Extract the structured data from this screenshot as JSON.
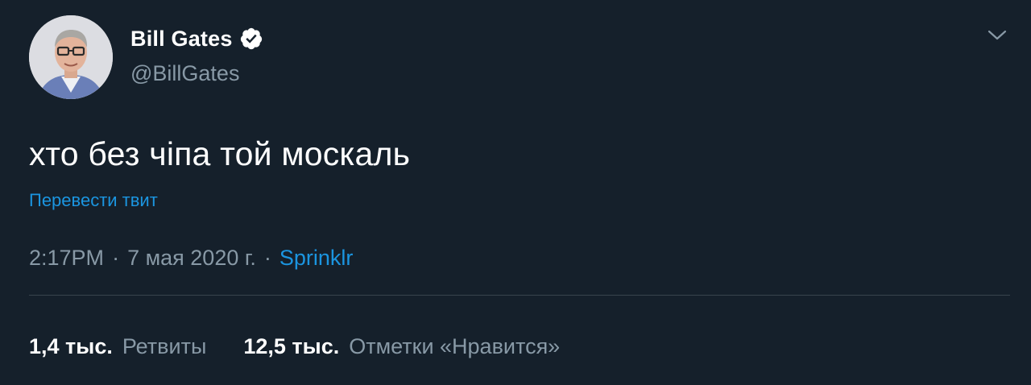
{
  "author": {
    "display_name": "Bill Gates",
    "handle": "@BillGates",
    "verified": true
  },
  "tweet": {
    "text": "хто без чіпа той москаль",
    "translate_label": "Перевести твит",
    "time": "2:17PM",
    "date": "7 мая 2020 г.",
    "separator": "·",
    "source": "Sprinklr"
  },
  "stats": {
    "retweets_count": "1,4 тыс.",
    "retweets_label": "Ретвиты",
    "likes_count": "12,5 тыс.",
    "likes_label": "Отметки «Нравится»"
  },
  "colors": {
    "background": "#15202b",
    "text_primary": "#ffffff",
    "text_secondary": "#8899a6",
    "link": "#1b95e0",
    "divider": "#38444d"
  },
  "icons": {
    "verified": "verified-badge-icon",
    "menu": "chevron-down-icon"
  }
}
